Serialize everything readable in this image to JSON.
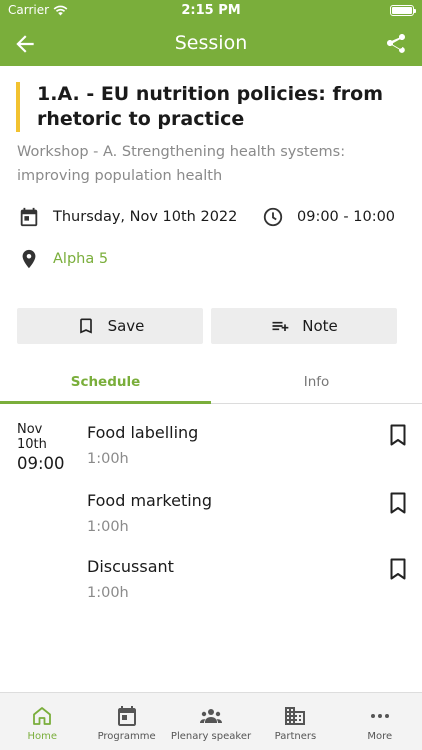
{
  "status_bar": {
    "carrier": "Carrier",
    "time": "2:15 PM"
  },
  "header": {
    "title": "Session"
  },
  "session": {
    "title": "1.A. - EU nutrition policies: from rhetoric to practice",
    "subtitle": "Workshop - A. Strengthening health systems: improving population health",
    "date": "Thursday, Nov 10th 2022",
    "time": "09:00 - 10:00",
    "location": "Alpha 5"
  },
  "actions": {
    "save_label": "Save",
    "note_label": "Note"
  },
  "tabs": [
    {
      "label": "Schedule",
      "active": true
    },
    {
      "label": "Info",
      "active": false
    }
  ],
  "schedule": {
    "month": "Nov",
    "day": "10th",
    "start": "09:00",
    "items": [
      {
        "title": "Food labelling",
        "duration": "1:00h"
      },
      {
        "title": "Food marketing",
        "duration": "1:00h"
      },
      {
        "title": "Discussant",
        "duration": "1:00h"
      }
    ]
  },
  "bottom_nav": [
    {
      "label": "Home",
      "icon": "home-icon",
      "active": true
    },
    {
      "label": "Programme",
      "icon": "calendar-icon",
      "active": false
    },
    {
      "label": "Plenary speaker",
      "icon": "people-icon",
      "active": false
    },
    {
      "label": "Partners",
      "icon": "building-icon",
      "active": false
    },
    {
      "label": "More",
      "icon": "more-icon",
      "active": false
    }
  ],
  "colors": {
    "accent": "#7aae3b",
    "highlight_bar": "#f2c230"
  }
}
